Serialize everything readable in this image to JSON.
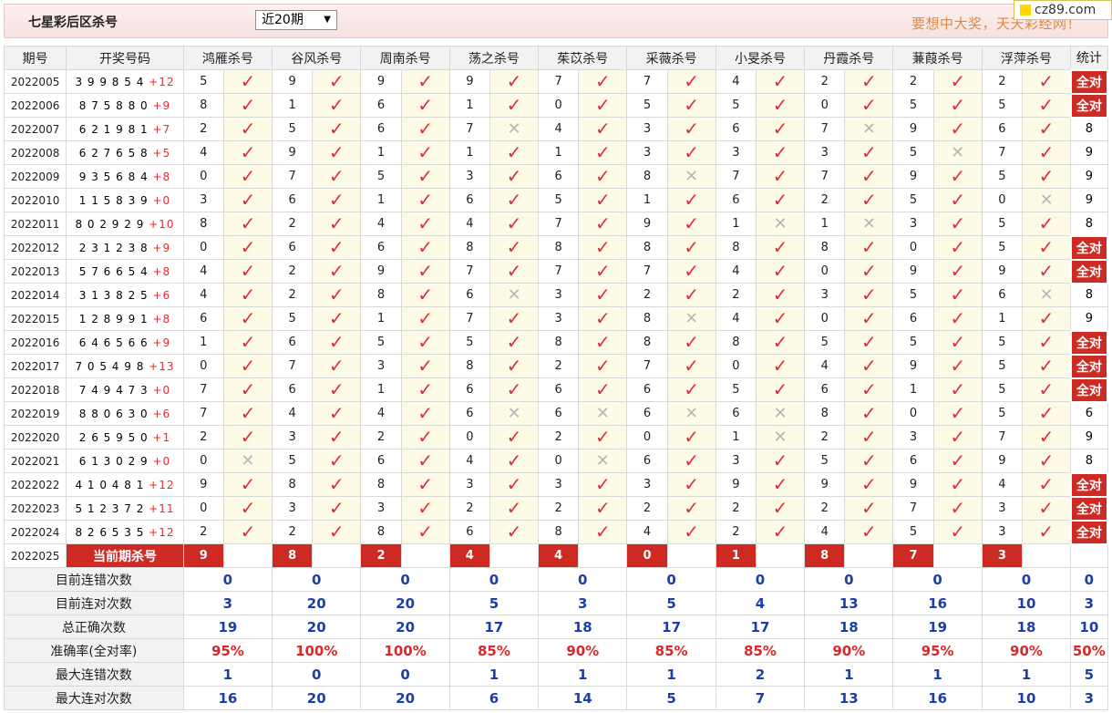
{
  "header": {
    "title": "七星彩后区杀号",
    "select_value": "近20期",
    "slogan": "要想中大奖，天天彩经网！",
    "logo": "cz89.com"
  },
  "columns": {
    "issue": "期号",
    "draw": "开奖号码",
    "stat": "统计",
    "experts": [
      "鸿雁杀号",
      "谷风杀号",
      "周南杀号",
      "荡之杀号",
      "茱苡杀号",
      "采薇杀号",
      "小旻杀号",
      "丹霞杀号",
      "蒹葭杀号",
      "浮萍杀号"
    ]
  },
  "rows": [
    {
      "issue": "2022005",
      "draw": "3 9 9 8 5 4",
      "back": "+12",
      "kills": [
        5,
        9,
        9,
        9,
        7,
        7,
        4,
        2,
        2,
        2
      ],
      "results": [
        1,
        1,
        1,
        1,
        1,
        1,
        1,
        1,
        1,
        1
      ],
      "stat": "全对"
    },
    {
      "issue": "2022006",
      "draw": "8 7 5 8 8 0",
      "back": "+9",
      "kills": [
        8,
        1,
        6,
        1,
        0,
        5,
        5,
        0,
        5,
        5
      ],
      "results": [
        1,
        1,
        1,
        1,
        1,
        1,
        1,
        1,
        1,
        1
      ],
      "stat": "全对"
    },
    {
      "issue": "2022007",
      "draw": "6 2 1 9 8 1",
      "back": "+7",
      "kills": [
        2,
        5,
        6,
        7,
        4,
        3,
        6,
        7,
        9,
        6
      ],
      "results": [
        1,
        1,
        1,
        0,
        1,
        1,
        1,
        0,
        1,
        1
      ],
      "stat": "8"
    },
    {
      "issue": "2022008",
      "draw": "6 2 7 6 5 8",
      "back": "+5",
      "kills": [
        4,
        9,
        1,
        1,
        1,
        3,
        3,
        3,
        5,
        7
      ],
      "results": [
        1,
        1,
        1,
        1,
        1,
        1,
        1,
        1,
        0,
        1
      ],
      "stat": "9"
    },
    {
      "issue": "2022009",
      "draw": "9 3 5 6 8 4",
      "back": "+8",
      "kills": [
        0,
        7,
        5,
        3,
        6,
        8,
        7,
        7,
        9,
        5
      ],
      "results": [
        1,
        1,
        1,
        1,
        1,
        0,
        1,
        1,
        1,
        1
      ],
      "stat": "9"
    },
    {
      "issue": "2022010",
      "draw": "1 1 5 8 3 9",
      "back": "+0",
      "kills": [
        3,
        6,
        1,
        6,
        5,
        1,
        6,
        2,
        5,
        0
      ],
      "results": [
        1,
        1,
        1,
        1,
        1,
        1,
        1,
        1,
        1,
        0
      ],
      "stat": "9"
    },
    {
      "issue": "2022011",
      "draw": "8 0 2 9 2 9",
      "back": "+10",
      "kills": [
        8,
        2,
        4,
        4,
        7,
        9,
        1,
        1,
        3,
        5
      ],
      "results": [
        1,
        1,
        1,
        1,
        1,
        1,
        0,
        0,
        1,
        1
      ],
      "stat": "8"
    },
    {
      "issue": "2022012",
      "draw": "2 3 1 2 3 8",
      "back": "+9",
      "kills": [
        0,
        6,
        6,
        8,
        8,
        8,
        8,
        8,
        0,
        5
      ],
      "results": [
        1,
        1,
        1,
        1,
        1,
        1,
        1,
        1,
        1,
        1
      ],
      "stat": "全对"
    },
    {
      "issue": "2022013",
      "draw": "5 7 6 6 5 4",
      "back": "+8",
      "kills": [
        4,
        2,
        9,
        7,
        7,
        7,
        4,
        0,
        9,
        9
      ],
      "results": [
        1,
        1,
        1,
        1,
        1,
        1,
        1,
        1,
        1,
        1
      ],
      "stat": "全对"
    },
    {
      "issue": "2022014",
      "draw": "3 1 3 8 2 5",
      "back": "+6",
      "kills": [
        4,
        2,
        8,
        6,
        3,
        2,
        2,
        3,
        5,
        6
      ],
      "results": [
        1,
        1,
        1,
        0,
        1,
        1,
        1,
        1,
        1,
        0
      ],
      "stat": "8"
    },
    {
      "issue": "2022015",
      "draw": "1 2 8 9 9 1",
      "back": "+8",
      "kills": [
        6,
        5,
        1,
        7,
        3,
        8,
        4,
        0,
        6,
        1
      ],
      "results": [
        1,
        1,
        1,
        1,
        1,
        0,
        1,
        1,
        1,
        1
      ],
      "stat": "9"
    },
    {
      "issue": "2022016",
      "draw": "6 4 6 5 6 6",
      "back": "+9",
      "kills": [
        1,
        6,
        5,
        5,
        8,
        8,
        8,
        5,
        5,
        5
      ],
      "results": [
        1,
        1,
        1,
        1,
        1,
        1,
        1,
        1,
        1,
        1
      ],
      "stat": "全对"
    },
    {
      "issue": "2022017",
      "draw": "7 0 5 4 9 8",
      "back": "+13",
      "kills": [
        0,
        7,
        3,
        8,
        2,
        7,
        0,
        4,
        9,
        5
      ],
      "results": [
        1,
        1,
        1,
        1,
        1,
        1,
        1,
        1,
        1,
        1
      ],
      "stat": "全对"
    },
    {
      "issue": "2022018",
      "draw": "7 4 9 4 7 3",
      "back": "+0",
      "kills": [
        7,
        6,
        1,
        6,
        6,
        6,
        5,
        6,
        1,
        5
      ],
      "results": [
        1,
        1,
        1,
        1,
        1,
        1,
        1,
        1,
        1,
        1
      ],
      "stat": "全对"
    },
    {
      "issue": "2022019",
      "draw": "8 8 0 6 3 0",
      "back": "+6",
      "kills": [
        7,
        4,
        4,
        6,
        6,
        6,
        6,
        8,
        0,
        5
      ],
      "results": [
        1,
        1,
        1,
        0,
        0,
        0,
        0,
        1,
        1,
        1
      ],
      "stat": "6"
    },
    {
      "issue": "2022020",
      "draw": "2 6 5 9 5 0",
      "back": "+1",
      "kills": [
        2,
        3,
        2,
        0,
        2,
        0,
        1,
        2,
        3,
        7
      ],
      "results": [
        1,
        1,
        1,
        1,
        1,
        1,
        0,
        1,
        1,
        1
      ],
      "stat": "9"
    },
    {
      "issue": "2022021",
      "draw": "6 1 3 0 2 9",
      "back": "+0",
      "kills": [
        0,
        5,
        6,
        4,
        0,
        6,
        3,
        5,
        6,
        9
      ],
      "results": [
        0,
        1,
        1,
        1,
        0,
        1,
        1,
        1,
        1,
        1
      ],
      "stat": "8"
    },
    {
      "issue": "2022022",
      "draw": "4 1 0 4 8 1",
      "back": "+12",
      "kills": [
        9,
        8,
        8,
        3,
        3,
        3,
        9,
        9,
        9,
        4
      ],
      "results": [
        1,
        1,
        1,
        1,
        1,
        1,
        1,
        1,
        1,
        1
      ],
      "stat": "全对"
    },
    {
      "issue": "2022023",
      "draw": "5 1 2 3 7 2",
      "back": "+11",
      "kills": [
        0,
        3,
        3,
        2,
        2,
        2,
        2,
        2,
        7,
        3
      ],
      "results": [
        1,
        1,
        1,
        1,
        1,
        1,
        1,
        1,
        1,
        1
      ],
      "stat": "全对"
    },
    {
      "issue": "2022024",
      "draw": "8 2 6 5 3 5",
      "back": "+12",
      "kills": [
        2,
        2,
        8,
        6,
        8,
        4,
        2,
        4,
        5,
        3
      ],
      "results": [
        1,
        1,
        1,
        1,
        1,
        1,
        1,
        1,
        1,
        1
      ],
      "stat": "全对"
    }
  ],
  "current": {
    "issue": "2022025",
    "label": "当前期杀号",
    "kills": [
      9,
      8,
      2,
      4,
      4,
      0,
      1,
      8,
      7,
      3
    ]
  },
  "summary": [
    {
      "label": "目前连错次数",
      "values": [
        "0",
        "0",
        "0",
        "0",
        "0",
        "0",
        "0",
        "0",
        "0",
        "0"
      ],
      "total": "0",
      "style": "blue"
    },
    {
      "label": "目前连对次数",
      "values": [
        "3",
        "20",
        "20",
        "5",
        "3",
        "5",
        "4",
        "13",
        "16",
        "10"
      ],
      "total": "3",
      "style": "blue"
    },
    {
      "label": "总正确次数",
      "values": [
        "19",
        "20",
        "20",
        "17",
        "18",
        "17",
        "17",
        "18",
        "19",
        "18"
      ],
      "total": "10",
      "style": "blue"
    },
    {
      "label": "准确率(全对率)",
      "values": [
        "95%",
        "100%",
        "100%",
        "85%",
        "90%",
        "85%",
        "85%",
        "90%",
        "95%",
        "90%"
      ],
      "total": "50%",
      "style": "red"
    },
    {
      "label": "最大连错次数",
      "values": [
        "1",
        "0",
        "0",
        "1",
        "1",
        "1",
        "2",
        "1",
        "1",
        "1"
      ],
      "total": "5",
      "style": "blue"
    },
    {
      "label": "最大连对次数",
      "values": [
        "16",
        "20",
        "20",
        "6",
        "14",
        "5",
        "7",
        "13",
        "16",
        "10"
      ],
      "total": "3",
      "style": "blue"
    }
  ],
  "icons": {
    "correct": "check-icon",
    "wrong": "cross-icon"
  },
  "colors": {
    "accent_red": "#cc2a22",
    "check_red": "#e02d3c",
    "stat_blue": "#1c3ea8",
    "slogan_orange": "#e08a3c"
  }
}
